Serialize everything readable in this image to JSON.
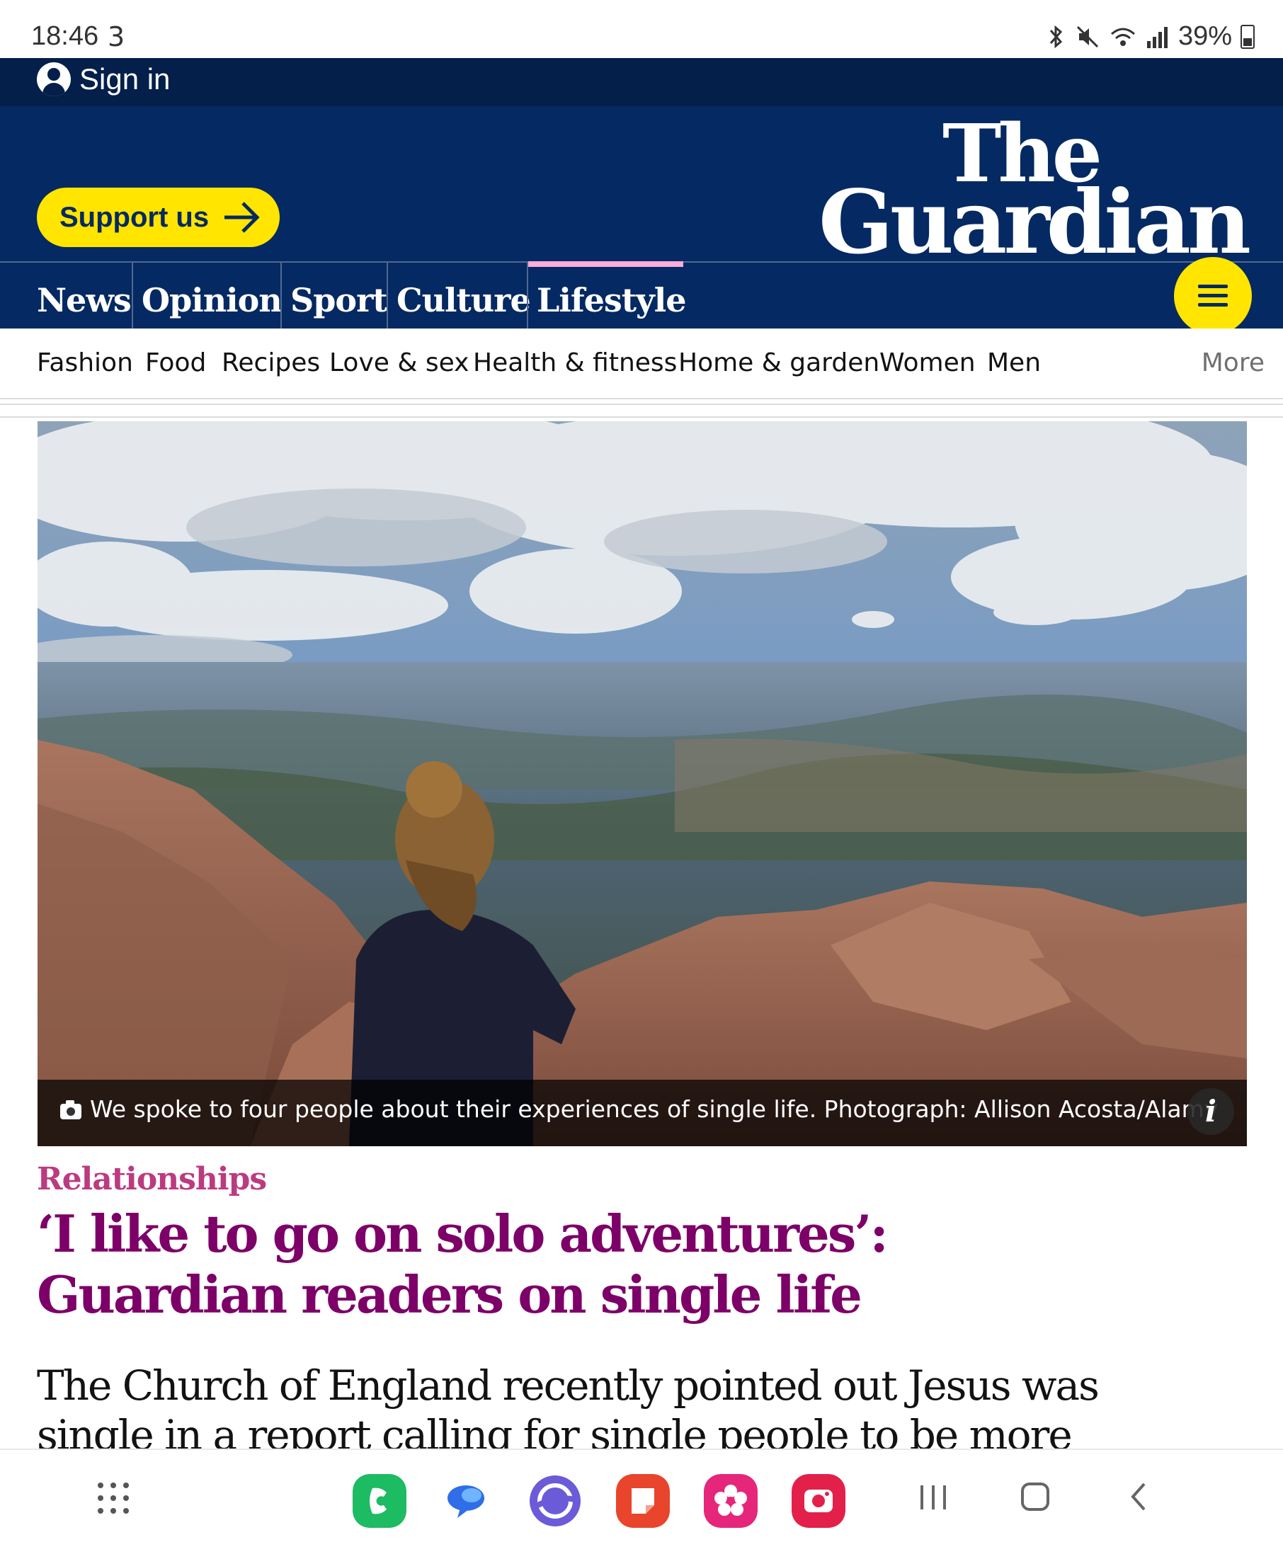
{
  "status_bar": {
    "time": "18:46",
    "carrier_icon": "3",
    "icons": [
      "bluetooth-icon",
      "mute-icon",
      "wifi-icon",
      "signal-icon"
    ],
    "battery": "39%"
  },
  "header": {
    "sign_in": "Sign in",
    "support_label": "Support us",
    "logo_line1": "The",
    "logo_line2": "Guardian",
    "colors": {
      "brand_blue": "#052962",
      "yellow": "#ffe500",
      "lifestyle_pink": "#ffabdb"
    }
  },
  "pillars": [
    {
      "label": "News",
      "active": false
    },
    {
      "label": "Opinion",
      "active": false
    },
    {
      "label": "Sport",
      "active": false
    },
    {
      "label": "Culture",
      "active": false
    },
    {
      "label": "Lifestyle",
      "active": true
    }
  ],
  "subnav": {
    "items": [
      "Fashion",
      "Food",
      "Recipes",
      "Love & sex",
      "Health & fitness",
      "Home & garden",
      "Women",
      "Men"
    ],
    "more": "More"
  },
  "hero": {
    "caption": "We spoke to four people about their experiences of single life. Photograph: Allison Acosta/Alamy",
    "info": "i"
  },
  "article": {
    "kicker": "Relationships",
    "headline": "‘I like to go on solo adventures’: Guardian readers on single life",
    "standfirst": "The Church of England recently pointed out Jesus was single in a report calling for single people to be more",
    "colors": {
      "kicker": "#bb3b80",
      "headline": "#7d0068"
    }
  },
  "dock": {
    "apps": [
      "phone-app-icon",
      "messages-app-icon",
      "internet-app-icon",
      "notes-app-icon",
      "flower-app-icon",
      "camera-app-icon"
    ],
    "nav": [
      "recents-icon",
      "home-icon",
      "back-icon"
    ]
  }
}
